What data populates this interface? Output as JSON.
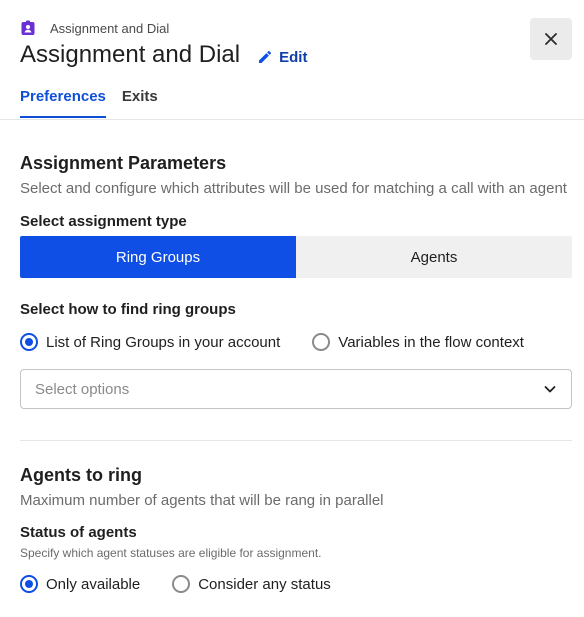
{
  "header": {
    "breadcrumb": "Assignment and Dial",
    "title": "Assignment and Dial",
    "edit_label": "Edit",
    "breadcrumb_icon": "badge-icon",
    "accent_purple": "#6b2fd6"
  },
  "tabs": [
    {
      "label": "Preferences",
      "active": true
    },
    {
      "label": "Exits",
      "active": false
    }
  ],
  "assignment": {
    "title": "Assignment Parameters",
    "subtitle": "Select and configure which attributes will be used for matching a call with an agent",
    "type_label": "Select assignment type",
    "types": [
      {
        "label": "Ring Groups",
        "selected": true
      },
      {
        "label": "Agents",
        "selected": false
      }
    ],
    "find_label": "Select how to find ring groups",
    "find_options": [
      {
        "label": "List of Ring Groups in your account",
        "selected": true
      },
      {
        "label": "Variables in the flow context",
        "selected": false
      }
    ],
    "select_placeholder": "Select options"
  },
  "agents": {
    "title": "Agents to ring",
    "subtitle": "Maximum number of agents that will be rang in parallel",
    "status_label": "Status of agents",
    "status_hint": "Specify which agent statuses are eligible for assignment.",
    "status_options": [
      {
        "label": "Only available",
        "selected": true
      },
      {
        "label": "Consider any status",
        "selected": false
      }
    ]
  },
  "colors": {
    "primary": "#0f4fe6",
    "link": "#0f3fa8"
  }
}
